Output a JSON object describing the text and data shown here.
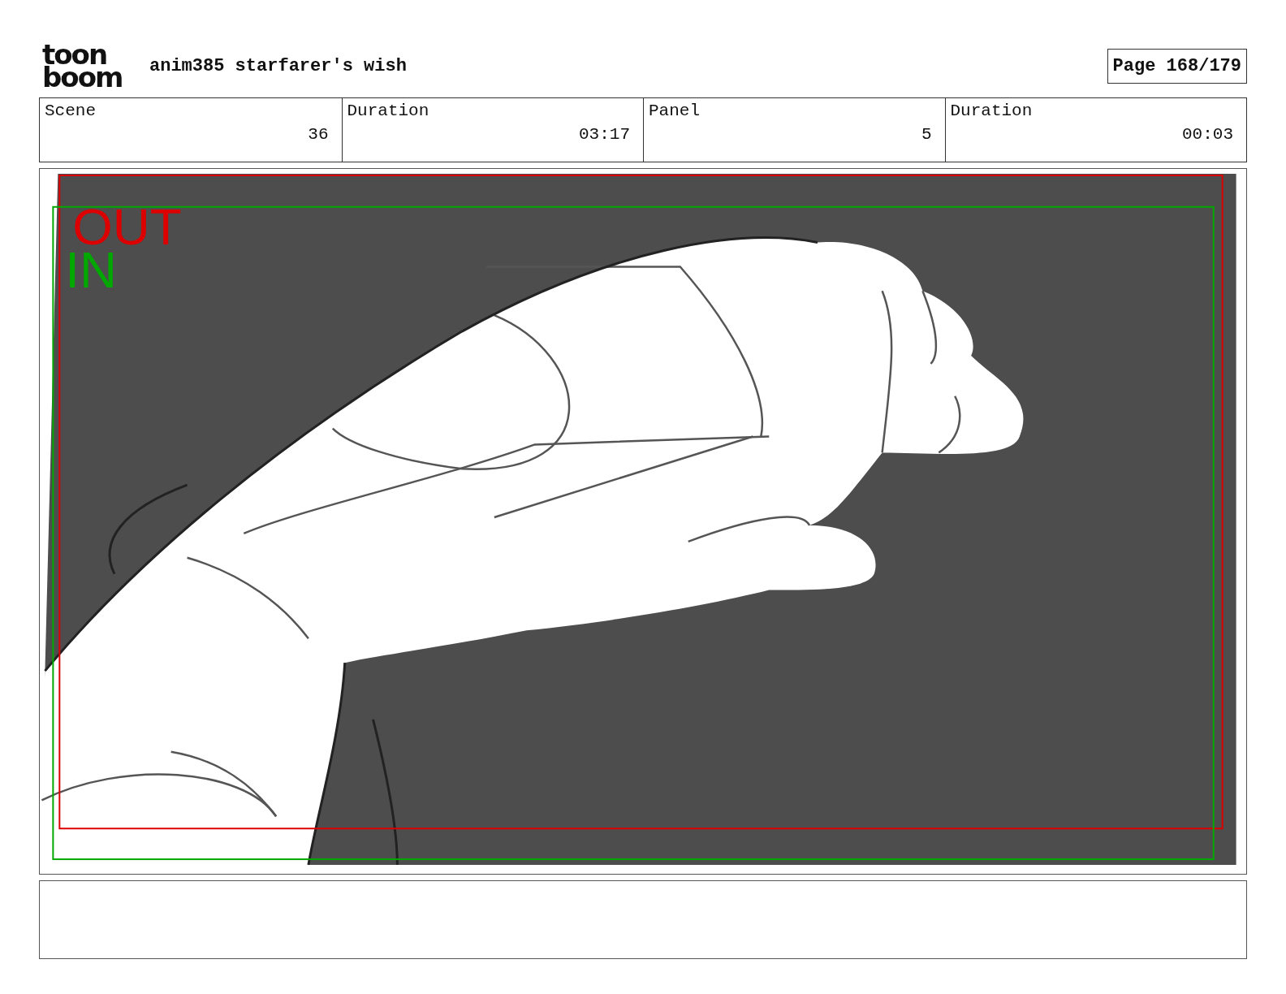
{
  "header": {
    "logo": [
      "toon",
      "boom"
    ],
    "project_title": "anim385 starfarer's wish",
    "page": "Page 168/179"
  },
  "info": [
    {
      "label": "Scene",
      "value": "36"
    },
    {
      "label": "Duration",
      "value": "03:17"
    },
    {
      "label": "Panel",
      "value": "5"
    },
    {
      "label": "Duration",
      "value": "00:03"
    }
  ],
  "panel": {
    "frames": [
      {
        "kind": "out",
        "label": "OUT",
        "color": "#dd0000"
      },
      {
        "kind": "in",
        "label": "IN",
        "color": "#00a800"
      }
    ]
  }
}
